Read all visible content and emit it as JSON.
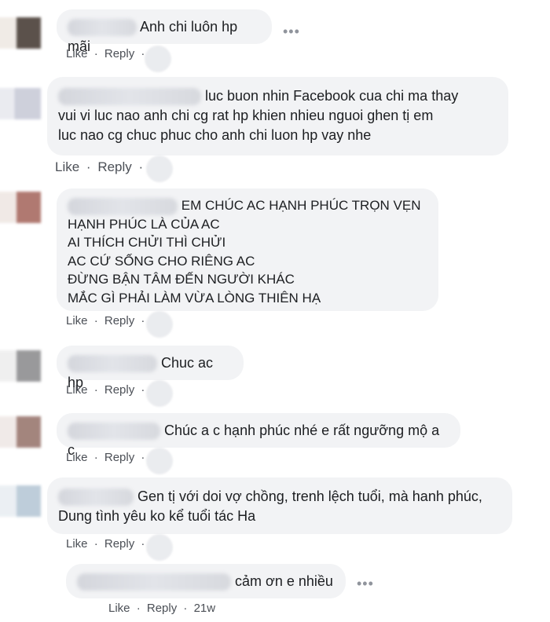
{
  "comments": [
    {
      "text": "Anh chi luôn hp mãi",
      "like": "Like",
      "reply": "Reply"
    },
    {
      "text": "luc buon nhin Facebook cua chi ma thay\nvui vi luc nao anh chi cg rat hp khien nhieu nguoi ghen tị em\nluc nao cg chuc phuc cho anh chi luon hp vay nhe",
      "like": "Like",
      "reply": "Reply"
    },
    {
      "text": "EM CHÚC AC HẠNH PHÚC TRỌN VẸN\nHẠNH PHÚC LÀ CỦA AC\nAI THÍCH CHỬI THÌ CHỬI\nAC CỨ SỐNG CHO RIÊNG AC\nĐỪNG BẬN TÂM ĐẾN NGƯỜI KHÁC\nMẮC GÌ PHẢI LÀM VỪA LÒNG THIÊN HẠ",
      "like": "Like",
      "reply": "Reply"
    },
    {
      "text": "Chuc ac hp",
      "like": "Like",
      "reply": "Reply"
    },
    {
      "text": "Chúc a c hạnh phúc nhé e rất ngưỡng mộ a c",
      "like": "Like",
      "reply": "Reply"
    },
    {
      "text": "Gen tị với doi vợ chồng, trenh lệch tuổi, mà hanh phúc,\nDung tình yêu ko kể tuổi tác Ha",
      "like": "Like",
      "reply": "Reply"
    }
  ],
  "reply_comment": {
    "text": "cảm ơn e nhiều",
    "like": "Like",
    "reply": "Reply",
    "time": "21w"
  },
  "dots": "•••",
  "separator": "·"
}
